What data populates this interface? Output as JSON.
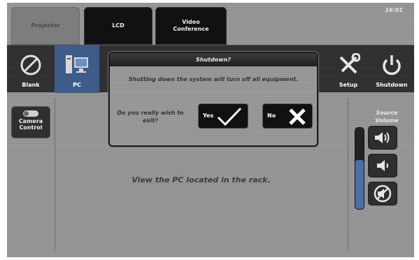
{
  "tabs": [
    {
      "label": "Projector",
      "active": true
    },
    {
      "label": "LCD",
      "active": false
    },
    {
      "label": "Video Conference",
      "active": false
    }
  ],
  "clock": "16:01",
  "bar": {
    "blank_label": "Blank",
    "pc_label": "PC",
    "setup_label": "Setup",
    "shutdown_label": "Shutdown"
  },
  "left_panel": {
    "camera_control_label": "Camera Control"
  },
  "main": {
    "message": "View the PC located in the rack."
  },
  "volume": {
    "title": "Source Volume",
    "level_fraction": 0.6
  },
  "dialog": {
    "title": "Shutdown?",
    "message": "Shutting down the system will turn off all equipment.",
    "question": "Do you really wish to exit?",
    "yes_label": "Yes",
    "no_label": "No"
  },
  "colors": {
    "pc_selected": "#3d5c8a",
    "volume_fill": "#4a6fa8"
  }
}
